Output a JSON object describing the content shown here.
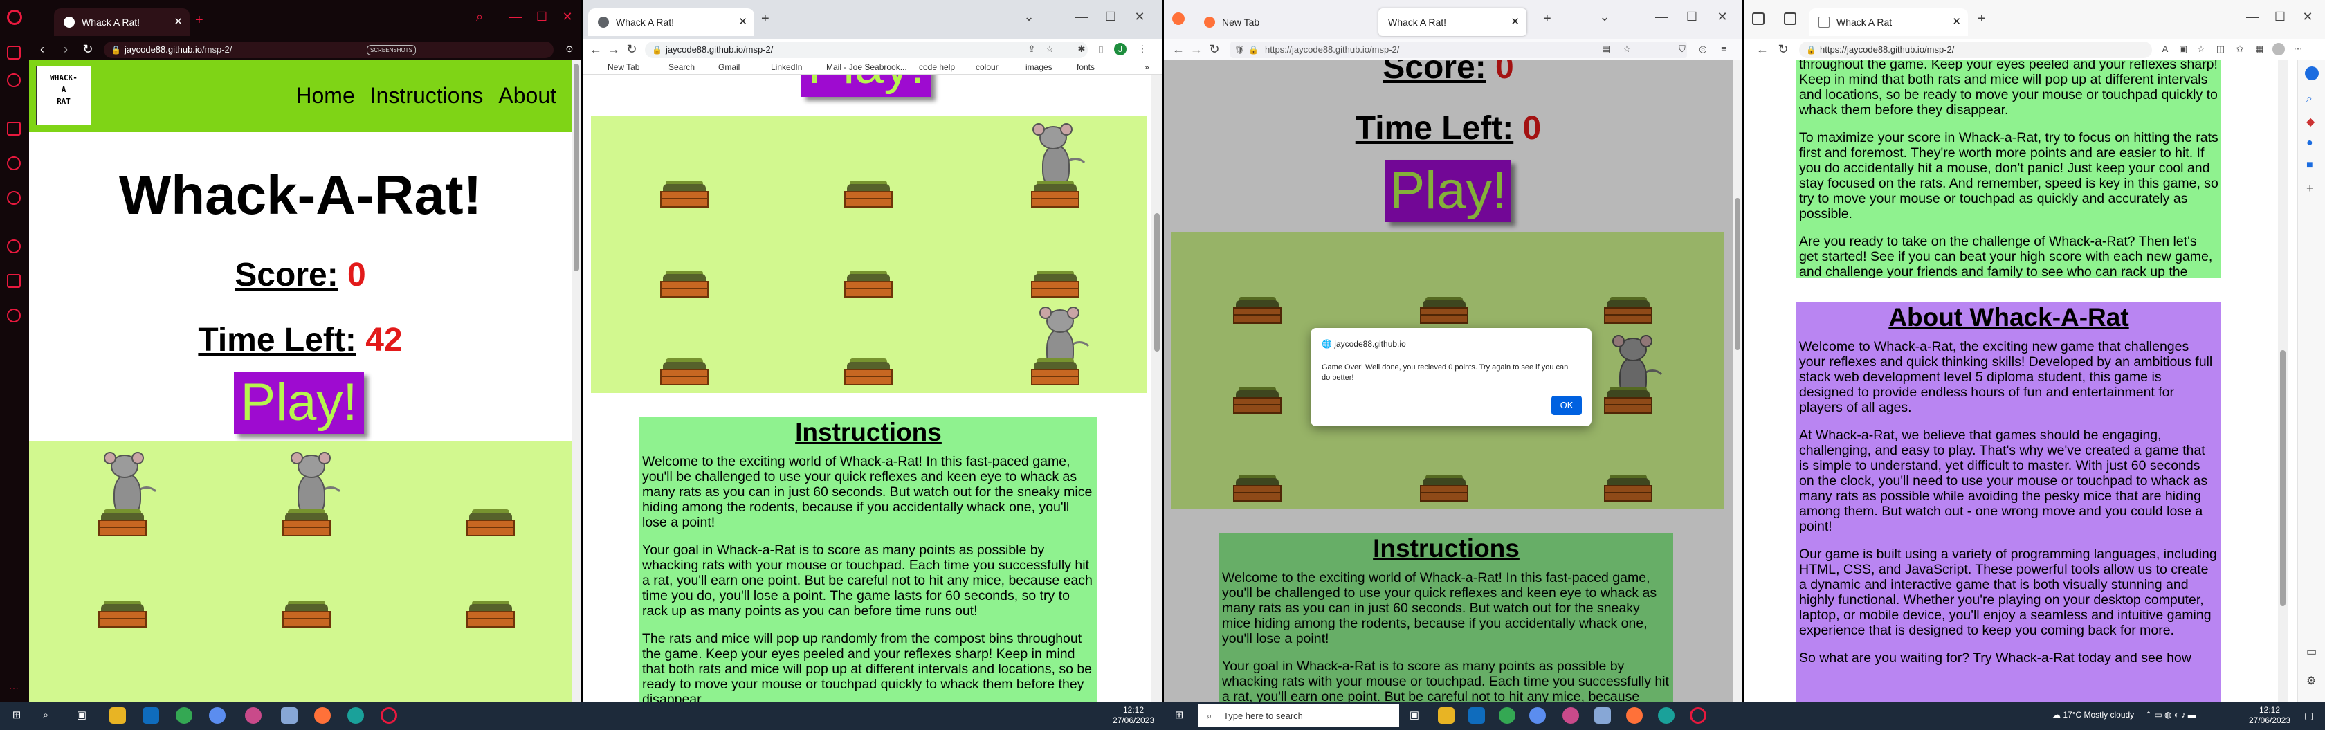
{
  "win1": {
    "tab_title": "Whack A Rat!",
    "url_host": "jaycode88.github.io",
    "url_path": "/msp-2/",
    "badge": "SCREENSHOTS"
  },
  "win2": {
    "tab_title": "Whack A Rat!",
    "url": "jaycode88.github.io/msp-2/",
    "bookmarks": [
      "New Tab",
      "Search",
      "Gmail",
      "LinkedIn",
      "Mail - Joe Seabrook...",
      "code help",
      "colour",
      "images",
      "fonts"
    ],
    "more_bookmarks": "»"
  },
  "win3": {
    "tab1_title": "New Tab",
    "tab2_title": "Whack A Rat!",
    "url": "https://jaycode88.github.io/msp-2/",
    "dialog": {
      "origin": "jaycode88.github.io",
      "message": "Game Over! Well done, you recieved 0 points. Try again to see if you can do better!",
      "ok_label": "OK"
    }
  },
  "win4": {
    "tab_title": "Whack A Rat",
    "url": "https://jaycode88.github.io/msp-2/"
  },
  "game": {
    "logo_lines": [
      "WHACK-",
      "A",
      "RAT"
    ],
    "nav": [
      "Home",
      "Instructions",
      "About"
    ],
    "title": "Whack-A-Rat!",
    "score_label": "Score:",
    "score_value_1": "0",
    "time_label": "Time Left:",
    "time_value_1": "42",
    "score_value_3": "0",
    "time_value_3": "0",
    "play_label": "Play!"
  },
  "instructions": {
    "heading": "Instructions",
    "p1": "Welcome to the exciting world of Whack-a-Rat! In this fast-paced game, you'll be challenged to use your quick reflexes and keen eye to whack as many rats as you can in just 60 seconds. But watch out for the sneaky mice hiding among the rodents, because if you accidentally whack one, you'll lose a point!",
    "p2": "Your goal in Whack-a-Rat is to score as many points as possible by whacking rats with your mouse or touchpad. Each time you successfully hit a rat, you'll earn one point. But be careful not to hit any mice, because each time you do, you'll lose a point. The game lasts for 60 seconds, so try to rack up as many points as you can before time runs out!",
    "p3": "The rats and mice will pop up randomly from the compost bins throughout the game. Keep your eyes peeled and your reflexes sharp! Keep in mind that both rats and mice will pop up at different intervals and locations, so be ready to move your mouse or touchpad quickly to whack them before they disappear.",
    "p4": "To maximize your score in Whack-a-Rat, try to focus on hitting the rats first and foremost. They're worth more points and are easier to hit. If you do accidentally hit a mouse, don't panic! Just keep your cool and stay focused on the rats. And remember, speed is key in this game, so try to move your mouse or touchpad as quickly and accurately as possible.",
    "p5": "Are you ready to take on the challenge of Whack-a-Rat? Then let's get started! See if you can beat your high score with each new game, and challenge your friends and family to see who can rack up the most points. Good luck, and happy whacking!"
  },
  "about": {
    "heading": "About Whack-A-Rat",
    "p1": "Welcome to Whack-a-Rat, the exciting new game that challenges your reflexes and quick thinking skills! Developed by an ambitious full stack web development level 5 diploma student, this game is designed to provide endless hours of fun and entertainment for players of all ages.",
    "p2": "At Whack-a-Rat, we believe that games should be engaging, challenging, and easy to play. That's why we've created a game that is simple to understand, yet difficult to master. With just 60 seconds on the clock, you'll need to use your mouse or touchpad to whack as many rats as possible while avoiding the pesky mice that are hiding among them. But watch out - one wrong move and you could lose a point!",
    "p3": "Our game is built using a variety of programming languages, including HTML, CSS, and JavaScript. These powerful tools allow us to create a dynamic and interactive game that is both visually stunning and highly functional. Whether you're playing on your desktop computer, laptop, or mobile device, you'll enjoy a seamless and intuitive gaming experience that is designed to keep you coming back for more.",
    "p4": "So what are you waiting for? Try Whack-a-Rat today and see how"
  },
  "taskbar": {
    "clock_time_1": "12:12",
    "clock_date_1": "27/06/2023",
    "search_placeholder": "Type here to search",
    "weather": "17°C  Mostly cloudy",
    "clock_time_2": "12:12",
    "clock_date_2": "27/06/2023"
  },
  "colors": {
    "header_green": "#7fd416",
    "board_green": "#d2f88f",
    "instructions_bg": "#8ff28f",
    "about_bg": "#b985f2",
    "play_purple": "#9e0bd0",
    "play_text": "#b7f44f",
    "score_red": "#e21a1a"
  }
}
